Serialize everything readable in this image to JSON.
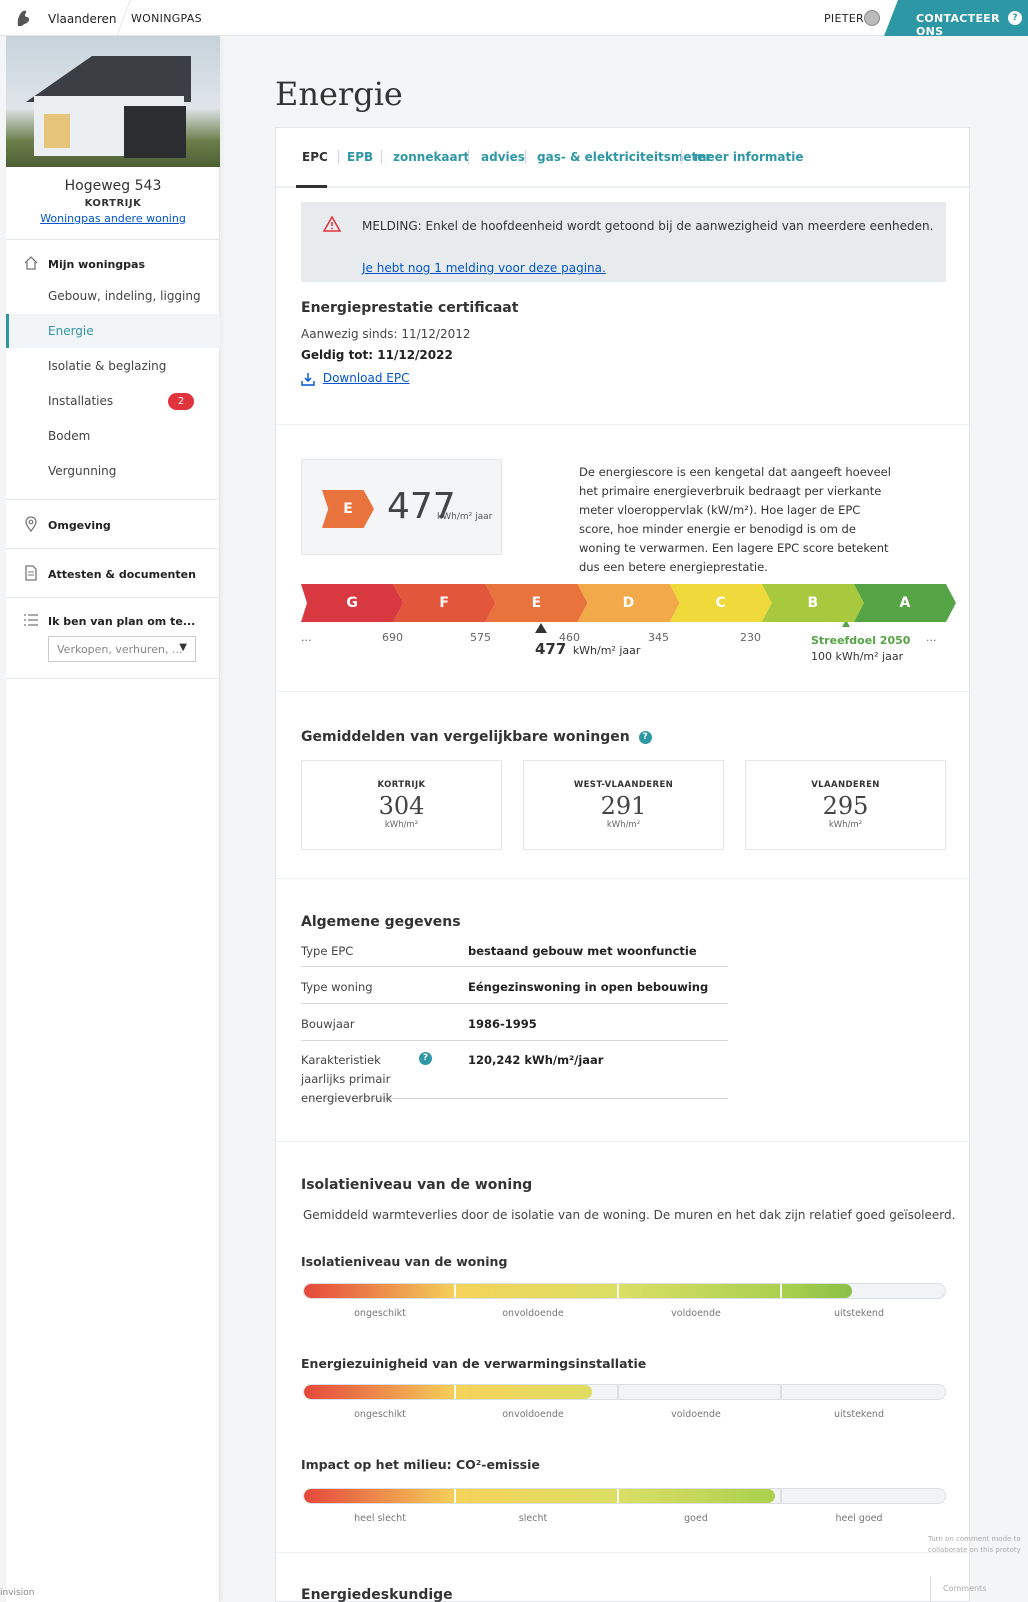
{
  "header": {
    "brand": "Vlaanderen",
    "product": "WONINGPAS",
    "user": "PIETER",
    "contact_label": "CONTACTEER ONS",
    "help_glyph": "?"
  },
  "sidebar": {
    "address": "Hogeweg 543",
    "city": "KORTRIJK",
    "other_home": "Woningpas andere woning",
    "section_home": "Mijn woningpas",
    "items": [
      {
        "label": "Gebouw, indeling, ligging"
      },
      {
        "label": "Energie"
      },
      {
        "label": "Isolatie & beglazing"
      },
      {
        "label": "Installaties",
        "badge": "2"
      },
      {
        "label": "Bodem"
      },
      {
        "label": "Vergunning"
      }
    ],
    "section_env": "Omgeving",
    "section_docs": "Attesten & documenten",
    "section_plan": "Ik ben van plan om te...",
    "plan_select": "Verkopen, verhuren, ..."
  },
  "main": {
    "title": "Energie",
    "tabs": [
      "EPC",
      "EPB",
      "zonnekaart",
      "advies",
      "gas- & elektriciteitsmeter",
      "meer informatie"
    ],
    "notice": {
      "message": "MELDING: Enkel de hoofdeenheid wordt getoond bij de aanwezigheid van meerdere eenheden.",
      "link": "Je hebt nog 1 melding voor deze pagina."
    },
    "epc": {
      "heading": "Energieprestatie certificaat",
      "present_since": "Aanwezig sinds: 11/12/2012",
      "valid_until": "Geldig tot: 11/12/2022",
      "download": "Download EPC"
    },
    "score": {
      "label": "E",
      "value": "477",
      "unit": "kWh/m² jaar",
      "description": "De energiescore is een kengetal dat aangeeft hoeveel het primaire energieverbruik bedraagt per vierkante meter vloeroppervlak (kW/m²). Hoe lager de EPC score, hoe minder energie er benodigd is om de woning te verwarmen. Een lagere EPC score betekent dus een betere energieprestatie."
    },
    "scale": {
      "labels": [
        "G",
        "F",
        "E",
        "D",
        "C",
        "B",
        "A"
      ],
      "colors": [
        "#d8383f",
        "#e2573b",
        "#e8733c",
        "#f2a94a",
        "#f0d93a",
        "#a8c93e",
        "#55a546"
      ],
      "ticks": [
        "...",
        "690",
        "575",
        "460",
        "345",
        "230",
        "..."
      ],
      "current_value": "477",
      "current_unit": "kWh/m² jaar",
      "target_label": "Streefdoel 2050",
      "target_value": "100 kWh/m² jaar"
    },
    "averages": {
      "heading": "Gemiddelden van vergelijkbare woningen",
      "items": [
        {
          "location": "KORTRIJK",
          "value": "304",
          "unit": "kWh/m²"
        },
        {
          "location": "WEST-VLAANDEREN",
          "value": "291",
          "unit": "kWh/m²"
        },
        {
          "location": "VLAANDEREN",
          "value": "295",
          "unit": "kWh/m²"
        }
      ]
    },
    "general": {
      "heading": "Algemene gegevens",
      "rows": [
        {
          "key": "Type EPC",
          "value": "bestaand gebouw met woonfunctie"
        },
        {
          "key": "Type woning",
          "value": "Eéngezinswoning in open bebouwing"
        },
        {
          "key": "Bouwjaar",
          "value": "1986-1995"
        },
        {
          "key": "Karakteristiek jaarlijks primair energieverbruik",
          "value": "120,242 kWh/m²/jaar"
        }
      ]
    },
    "insulation": {
      "heading": "Isolatieniveau van de woning",
      "intro": "Gemiddeld warmteverlies door de isolatie van de woning. De muren en het dak zijn relatief goed geïsoleerd.",
      "bars": [
        {
          "title": "Isolatieniveau van de woning",
          "fraction": 0.855,
          "labels": [
            "ongeschikt",
            "onvoldoende",
            "voldoende",
            "uitstekend"
          ]
        },
        {
          "title": "Energiezuinigheid van de verwarmingsinstallatie",
          "fraction": 0.45,
          "labels": [
            "ongeschikt",
            "onvoldoende",
            "voldoende",
            "uitstekend"
          ]
        },
        {
          "title": "Impact op het milieu: CO²-emissie",
          "fraction": 0.735,
          "labels": [
            "heel slecht",
            "slecht",
            "goed",
            "heel goed"
          ]
        }
      ]
    },
    "next_heading": "Energiedeskundige"
  },
  "overlay": {
    "comment_hint": "Turn on comment mode to collaborate on this prototy",
    "comments": "Comments",
    "invision": "invision"
  }
}
